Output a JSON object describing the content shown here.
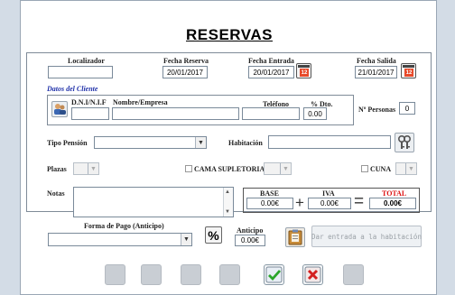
{
  "title": "RESERVAS",
  "header": {
    "localizador_label": "Localizador",
    "localizador_value": "",
    "fecha_reserva_label": "Fecha Reserva",
    "fecha_reserva_value": "20/01/2017",
    "fecha_entrada_label": "Fecha Entrada",
    "fecha_entrada_value": "20/01/2017",
    "fecha_salida_label": "Fecha Salida",
    "fecha_salida_value": "21/01/2017",
    "calendar_number": "12"
  },
  "cliente": {
    "section_label": "Datos del Cliente",
    "dni_label": "D.N.I/N.I.F",
    "dni_value": "",
    "nombre_label": "Nombre/Empresa",
    "nombre_value": "",
    "telefono_label": "Teléfono",
    "telefono_value": "",
    "dto_label": "% Dto.",
    "dto_value": "0.00",
    "personas_label": "Nº Personas",
    "personas_value": "0"
  },
  "pension": {
    "label": "Tipo Pensión",
    "value": ""
  },
  "habitacion": {
    "label": "Habitación",
    "value": ""
  },
  "plazas": {
    "label": "Plazas",
    "value": ""
  },
  "cama_supletoria": {
    "label": "CAMA SUPLETORIA",
    "value": ""
  },
  "cuna": {
    "label": "CUNA",
    "value": ""
  },
  "notas": {
    "label": "Notas",
    "value": ""
  },
  "totals": {
    "base_label": "BASE",
    "base_value": "0.00€",
    "iva_label": "IVA",
    "iva_value": "0.00€",
    "total_label": "TOTAL",
    "total_value": "0.00€",
    "plus_sign": "+",
    "equals_sign": "="
  },
  "pago": {
    "forma_label": "Forma de Pago (Anticipo)",
    "forma_value": "",
    "percent_symbol": "%",
    "anticipo_label": "Anticipo",
    "anticipo_value": "0.00€"
  },
  "dar_entrada_label": "Dar entrada a la habitación",
  "colors": {
    "total_red": "#d11111",
    "section_blue": "#2233aa",
    "accept_green": "#2aa52a",
    "cancel_red": "#d32020"
  }
}
